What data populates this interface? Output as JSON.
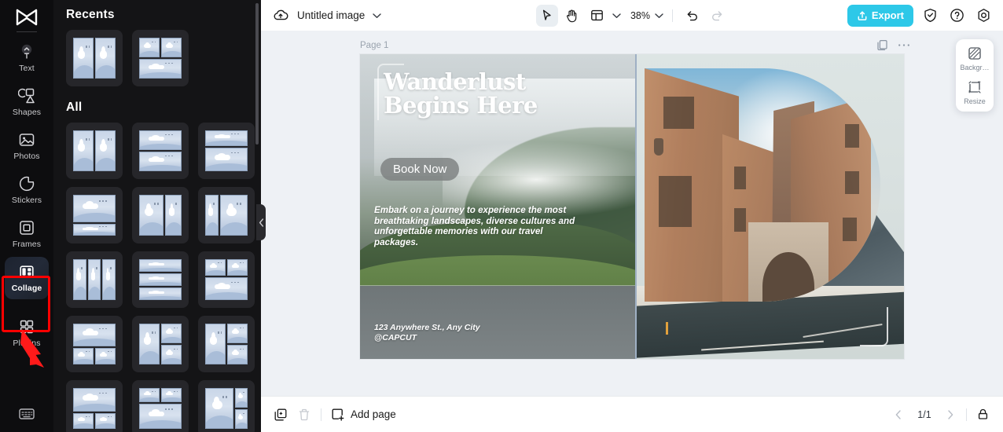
{
  "rail": {
    "logo": "capcut-logo",
    "items": [
      {
        "label": "Text",
        "icon": "text-icon",
        "active": false
      },
      {
        "label": "Shapes",
        "icon": "shapes-icon",
        "active": false
      },
      {
        "label": "Photos",
        "icon": "photos-icon",
        "active": false
      },
      {
        "label": "Stickers",
        "icon": "stickers-icon",
        "active": false
      },
      {
        "label": "Frames",
        "icon": "frames-icon",
        "active": false
      },
      {
        "label": "Collage",
        "icon": "collage-icon",
        "active": true
      },
      {
        "label": "Plugins",
        "icon": "plugins-icon",
        "active": false
      }
    ],
    "bottom_icon": "keyboard-icon",
    "highlight_color": "#ff0000",
    "highlighted_item": "Collage"
  },
  "panel": {
    "sections": [
      {
        "title": "Recents",
        "count": 2
      },
      {
        "title": "All",
        "count": 16
      }
    ]
  },
  "topbar": {
    "cloud_icon": "cloud-save-icon",
    "doc_title": "Untitled image",
    "title_caret": "chevron-down-icon",
    "tools": [
      {
        "name": "select-tool",
        "icon": "cursor-icon",
        "selected": true
      },
      {
        "name": "hand-tool",
        "icon": "hand-icon",
        "selected": false
      },
      {
        "name": "layout-tool",
        "icon": "layout-icon",
        "selected": false
      }
    ],
    "layout_caret": "chevron-down-icon",
    "zoom": "38%",
    "zoom_caret": "chevron-down-icon",
    "undo": "undo-icon",
    "redo": "redo-icon",
    "export_label": "Export",
    "export_color": "#2dc8e8",
    "right_icons": [
      {
        "name": "shield-check-icon"
      },
      {
        "name": "help-icon"
      },
      {
        "name": "settings-icon"
      }
    ]
  },
  "canvas": {
    "page_label": "Page 1",
    "page_actions": [
      {
        "name": "duplicate-page-icon"
      },
      {
        "name": "more-options-icon"
      }
    ],
    "artwork": {
      "headline_line1": "Wanderlust",
      "headline_line2": "Begins Here",
      "cta_label": "Book Now",
      "body": "Embark on a journey to experience the most breathtaking landscapes, diverse cultures and unforgettable memories with our travel packages.",
      "address": "123 Anywhere St., Any City",
      "handle": "@CAPCUT"
    }
  },
  "float_panel": {
    "items": [
      {
        "label": "Backgr…",
        "icon": "background-icon"
      },
      {
        "label": "Resize",
        "icon": "resize-icon"
      }
    ]
  },
  "bottombar": {
    "duplicate_icon": "duplicate-icon",
    "delete_icon": "trash-icon",
    "add_page_label": "Add page",
    "add_page_icon": "add-page-icon",
    "prev_icon": "chevron-left-icon",
    "pager": "1/1",
    "next_icon": "chevron-right-icon",
    "lock_icon": "lock-icon"
  },
  "collapse_handle": {
    "icon": "chevron-left-icon"
  }
}
